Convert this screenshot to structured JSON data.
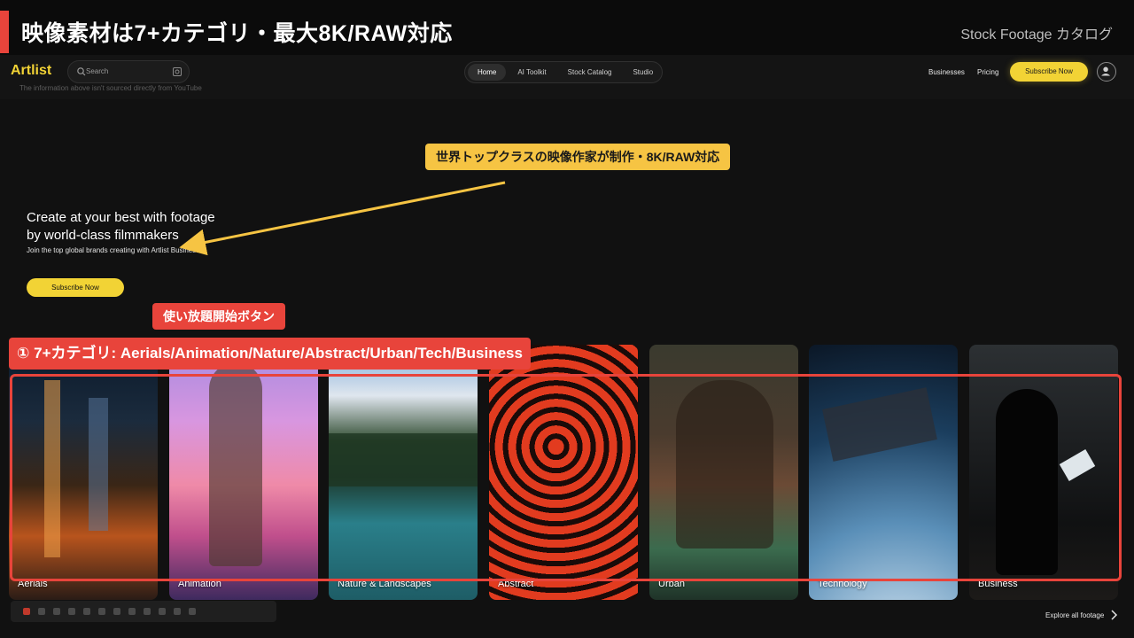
{
  "slide": {
    "title": "映像素材は7+カテゴリ・最大8K/RAW対応",
    "tag": "Stock Footage カタログ",
    "accent_color": "#e8443b"
  },
  "navbar": {
    "logo": "Artlist",
    "disclaimer": "The information above isn't sourced directly from YouTube",
    "search_placeholder": "Search",
    "tabs": [
      {
        "label": "Home",
        "active": true
      },
      {
        "label": "AI Toolkit",
        "active": false
      },
      {
        "label": "Stock Catalog",
        "active": false
      },
      {
        "label": "Studio",
        "active": false
      }
    ],
    "businesses": "Businesses",
    "pricing": "Pricing",
    "subscribe": "Subscribe Now",
    "brand_color": "#f2d335"
  },
  "hero": {
    "title_line1": "Create at your best with footage",
    "title_line2": "by world-class filmmakers",
    "subtitle": "Join the top global brands creating with Artlist Business",
    "button": "Subscribe Now"
  },
  "annotations": {
    "filmmakers": "世界トップクラスの映像作家が制作・8K/RAW対応",
    "subscribe_button": "使い放題開始ボタン",
    "categories": "① 7+カテゴリ: Aerials/Animation/Nature/Abstract/Urban/Tech/Business"
  },
  "categories": [
    {
      "label": "Aerials"
    },
    {
      "label": "Animation"
    },
    {
      "label": "Nature & Landscapes"
    },
    {
      "label": "Abstract"
    },
    {
      "label": "Urban"
    },
    {
      "label": "Technology"
    },
    {
      "label": "Business"
    }
  ],
  "footer": {
    "explore": "Explore all footage"
  }
}
